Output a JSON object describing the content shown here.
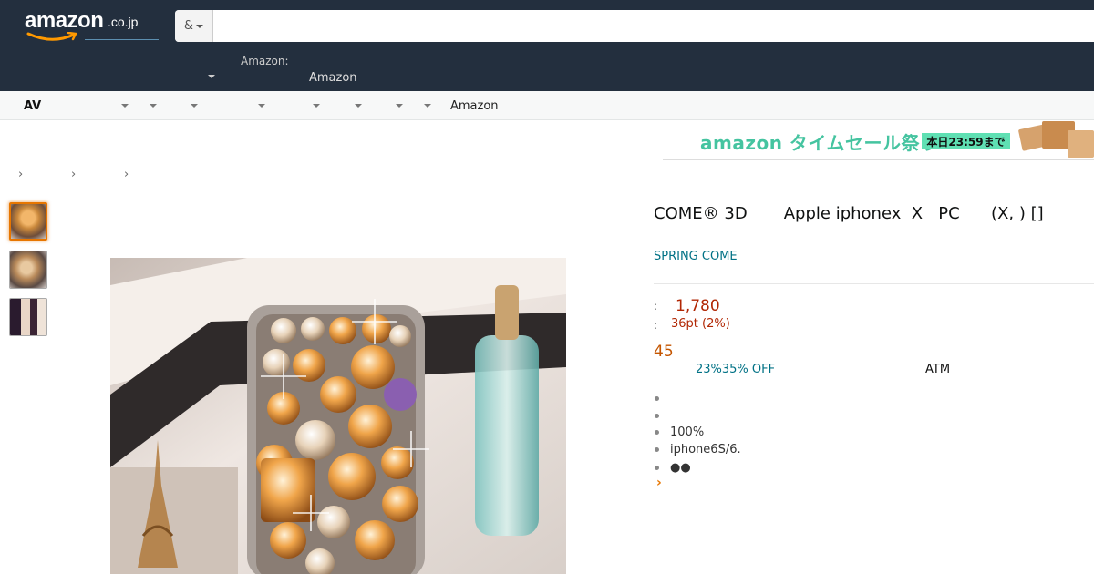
{
  "header": {
    "logo_text": "amazon",
    "logo_tld": ".co.jp",
    "search_category": "&",
    "search_placeholder": "",
    "nav_amazon_small": "Amazon:",
    "nav_amazon_big": "Amazon"
  },
  "subnav": {
    "first_item": "AV",
    "last_item": "Amazon"
  },
  "banner": {
    "text": "amazon タイムセール祭り",
    "badge": "本日23:59まで"
  },
  "breadcrumb": {
    "separators": [
      "›",
      "›",
      "›"
    ]
  },
  "product": {
    "title": "COME® 3D       Apple iphonex  X   PC      (X, ) []",
    "brand": "SPRING COME",
    "price_label": ":",
    "price": "1,780",
    "points_label": ":",
    "points": "36pt (2%)",
    "deal_number": "45",
    "off_text": "23%35% OFF",
    "atm_text": "ATM",
    "bullets": [
      "",
      "",
      "100%",
      "iphone6S/6.",
      "●●"
    ],
    "more_chevron": "›"
  },
  "colors": {
    "nav_bg": "#232f3e",
    "price": "#b12704",
    "link": "#007185",
    "deal": "#c45500",
    "thumb_active": "#e77600",
    "banner_green": "#45c4a0"
  }
}
